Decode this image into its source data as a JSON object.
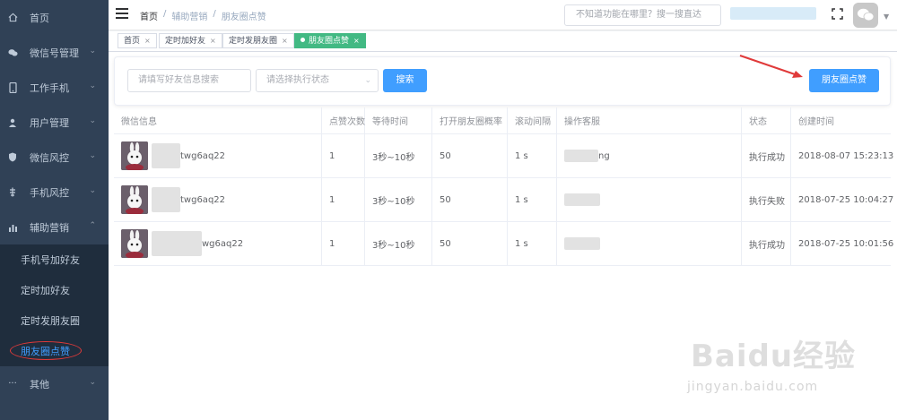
{
  "sidebar": {
    "items": [
      {
        "label": "首页",
        "icon": "home-icon",
        "has_caret": false
      },
      {
        "label": "微信号管理",
        "icon": "wechat-icon",
        "has_caret": true
      },
      {
        "label": "工作手机",
        "icon": "phone-icon",
        "has_caret": true
      },
      {
        "label": "用户管理",
        "icon": "user-icon",
        "has_caret": true
      },
      {
        "label": "微信风控",
        "icon": "shield-icon",
        "has_caret": true
      },
      {
        "label": "手机风控",
        "icon": "risk-icon",
        "has_caret": true
      },
      {
        "label": "辅助营销",
        "icon": "chart-icon",
        "has_caret": true,
        "expanded": true
      }
    ],
    "submenu": [
      {
        "label": "手机号加好友"
      },
      {
        "label": "定时加好友"
      },
      {
        "label": "定时发朋友圈"
      },
      {
        "label": "朋友圈点赞",
        "active": true
      }
    ],
    "other": {
      "label": "其他",
      "icon": "more-icon"
    }
  },
  "header": {
    "breadcrumb": [
      "首页",
      "辅助营销",
      "朋友圈点赞"
    ],
    "breadcrumb_sep": "/",
    "search_placeholder": "不知道功能在哪里？搜一搜直达"
  },
  "tabs": [
    {
      "label": "首页",
      "close": "×"
    },
    {
      "label": "定时加好友",
      "close": "×"
    },
    {
      "label": "定时发朋友圈",
      "close": "×"
    },
    {
      "label": "朋友圈点赞",
      "close": "×",
      "active": true
    }
  ],
  "filters": {
    "keyword_placeholder": "请填写好友信息搜索",
    "status_placeholder": "请选择执行状态",
    "search_button": "搜索",
    "like_button": "朋友圈点赞"
  },
  "table": {
    "columns": [
      "微信信息",
      "点赞次数",
      "等待时间",
      "打开朋友圈概率",
      "滚动间隔",
      "操作客服",
      "状态",
      "创建时间"
    ],
    "rows": [
      {
        "wx_name": "twg6aq22",
        "likes": "1",
        "wait": "3秒~10秒",
        "prob": "50",
        "interval": "1 s",
        "agent": "ng",
        "status": "执行成功",
        "created": "2018-08-07 15:23:13"
      },
      {
        "wx_name": "twg6aq22",
        "likes": "1",
        "wait": "3秒~10秒",
        "prob": "50",
        "interval": "1 s",
        "agent": "",
        "status": "执行失败",
        "created": "2018-07-25 10:04:27"
      },
      {
        "wx_name": "wg6aq22",
        "likes": "1",
        "wait": "3秒~10秒",
        "prob": "50",
        "interval": "1 s",
        "agent": "",
        "status": "执行成功",
        "created": "2018-07-25 10:01:56"
      }
    ]
  },
  "watermark": {
    "logo": "Baidu经验",
    "url": "jingyan.baidu.com"
  },
  "colors": {
    "sidebar_bg": "#304156",
    "submenu_bg": "#1f2d3d",
    "primary": "#409eff",
    "tag_active": "#42b983",
    "annotation": "#e03a3a"
  }
}
